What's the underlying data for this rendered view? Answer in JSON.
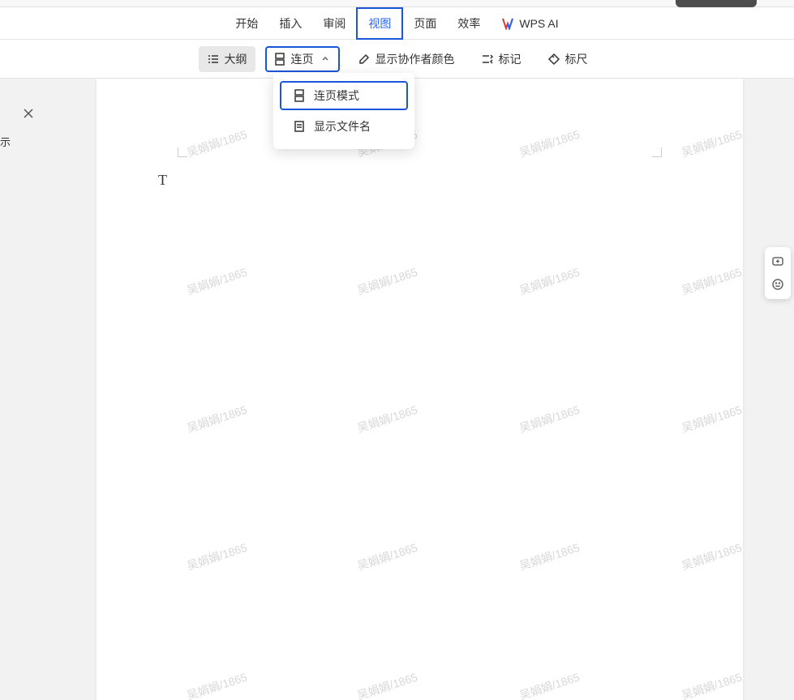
{
  "menu": {
    "items": [
      {
        "label": "开始"
      },
      {
        "label": "插入"
      },
      {
        "label": "审阅"
      },
      {
        "label": "视图",
        "active": true,
        "highlighted": true
      },
      {
        "label": "页面"
      },
      {
        "label": "效率"
      }
    ],
    "wps_ai_label": "WPS AI"
  },
  "toolbar": {
    "outline_label": "大纲",
    "continuous_page_label": "连页",
    "show_collab_color_label": "显示协作者颜色",
    "marks_label": "标记",
    "ruler_label": "标尺"
  },
  "dropdown": {
    "continuous_mode_label": "连页模式",
    "show_filename_label": "显示文件名"
  },
  "sidebar": {
    "label_partial": "示"
  },
  "document": {
    "cursor_glyph": "T",
    "watermark_text": "吴娟娟/1865"
  }
}
